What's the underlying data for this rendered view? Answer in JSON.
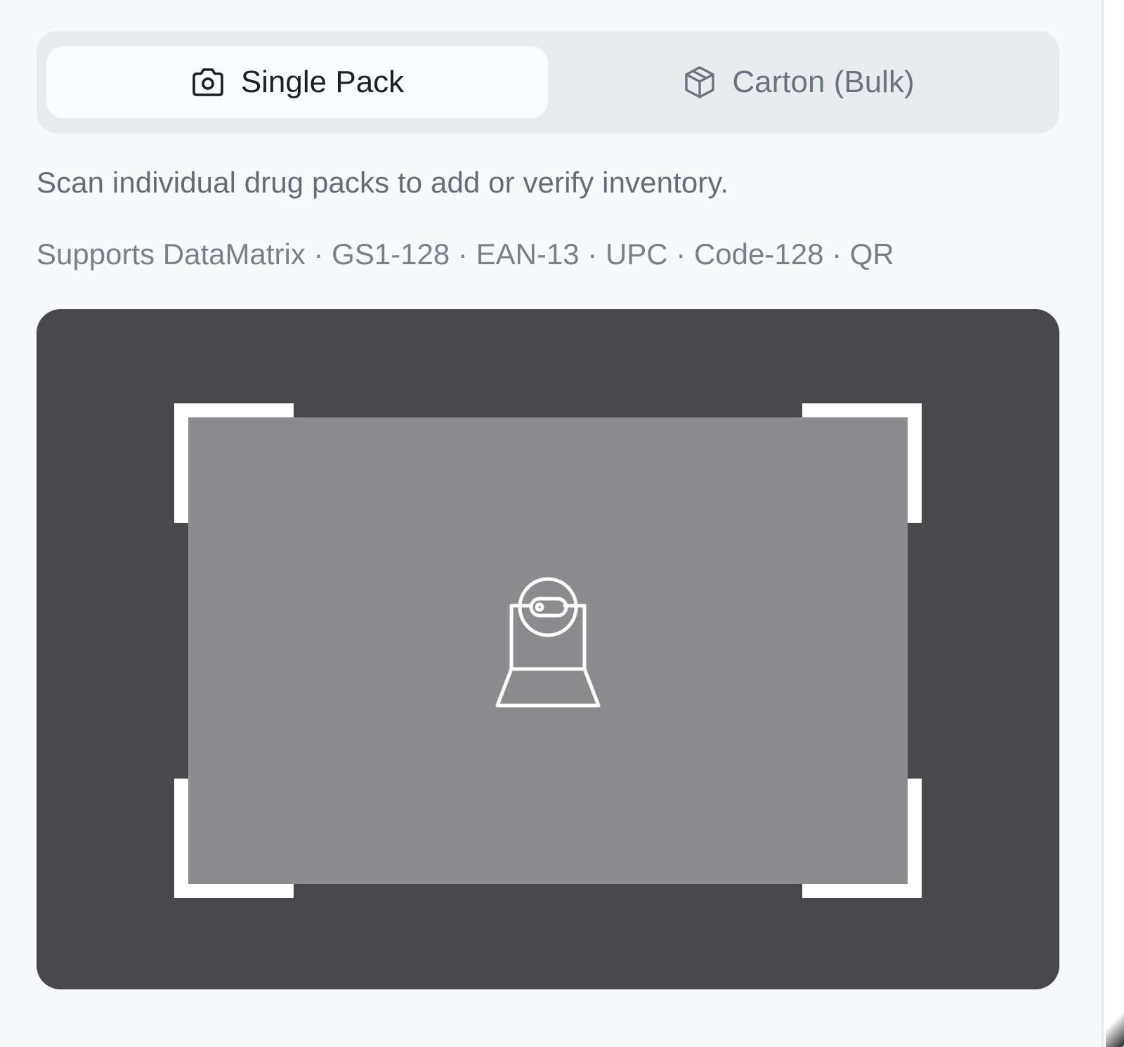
{
  "tabs": [
    {
      "label": "Single Pack",
      "icon": "camera-icon",
      "active": true
    },
    {
      "label": "Carton (Bulk)",
      "icon": "package-icon",
      "active": false
    }
  ],
  "description": "Scan individual drug packs to add or verify inventory.",
  "formats": "Supports DataMatrix · GS1-128 · EAN-13 · UPC · Code-128 · QR",
  "scanner": {
    "icon": "webcam-icon",
    "colors": {
      "frame": "#48484a",
      "viewfinder": "#8c8c8e",
      "brackets": "#ffffff"
    }
  }
}
